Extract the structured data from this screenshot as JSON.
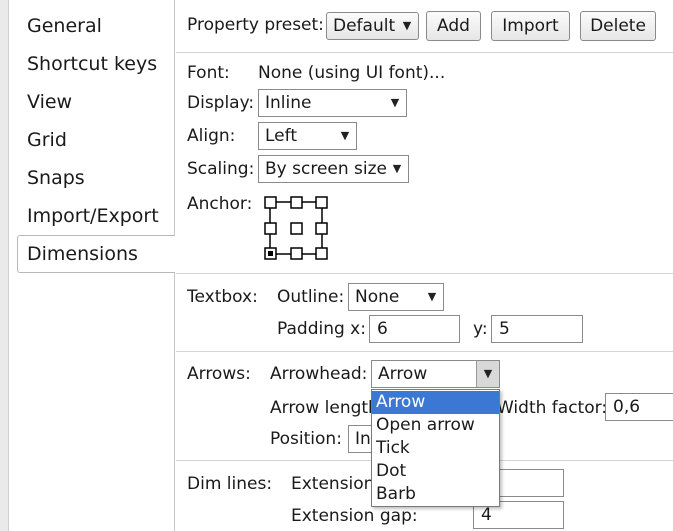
{
  "sidebar": {
    "items": [
      {
        "label": "General"
      },
      {
        "label": "Shortcut keys"
      },
      {
        "label": "View"
      },
      {
        "label": "Grid"
      },
      {
        "label": "Snaps"
      },
      {
        "label": "Import/Export"
      },
      {
        "label": "Dimensions"
      }
    ],
    "selected": "Dimensions"
  },
  "preset": {
    "label": "Property preset:",
    "value": "Default",
    "add_label": "Add",
    "import_label": "Import",
    "delete_label": "Delete"
  },
  "font": {
    "label": "Font:",
    "value": "None (using UI font)..."
  },
  "display": {
    "label": "Display:",
    "value": "Inline"
  },
  "align": {
    "label": "Align:",
    "value": "Left"
  },
  "scaling": {
    "label": "Scaling:",
    "value": "By screen size"
  },
  "anchor": {
    "label": "Anchor:"
  },
  "textbox": {
    "label": "Textbox:",
    "outline_label": "Outline:",
    "outline_value": "None",
    "padding_x_label": "Padding x:",
    "padding_x_value": "6",
    "y_label": "y:",
    "y_value": "5"
  },
  "arrows": {
    "label": "Arrows:",
    "arrowhead_label": "Arrowhead:",
    "arrowhead_value": "Arrow",
    "arrow_length_label": "Arrow length",
    "width_factor_label": "Width factor:",
    "width_factor_value": "0,6",
    "position_label": "Position:",
    "position_value": "In",
    "options": [
      "Arrow",
      "Open arrow",
      "Tick",
      "Dot",
      "Barb"
    ],
    "highlighted_option": "Arrow"
  },
  "dimlines": {
    "label": "Dim lines:",
    "extension_label": "Extension",
    "extension_gap_label": "Extension gap:",
    "extension_gap_value": "4"
  },
  "colors": {
    "highlight": "#3a78d4",
    "border": "#8a8a8a"
  }
}
